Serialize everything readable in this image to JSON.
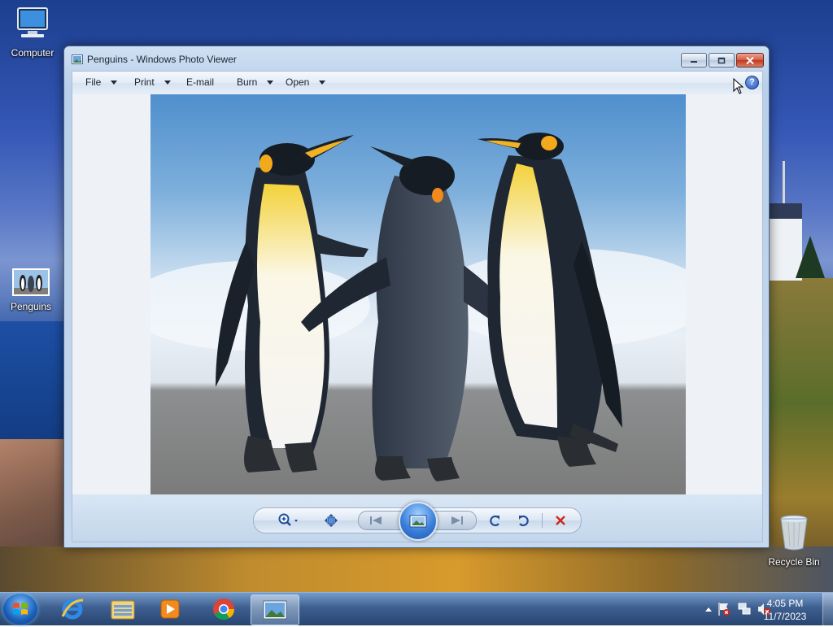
{
  "desktop": {
    "icons": [
      {
        "label": "Computer",
        "icon": "computer-icon"
      },
      {
        "label": "Penguins",
        "icon": "image-thumbnail-icon"
      },
      {
        "label": "Recycle Bin",
        "icon": "recycle-bin-icon"
      }
    ]
  },
  "window": {
    "title": "Penguins - Windows Photo Viewer",
    "app_icon": "photo-viewer-icon",
    "caption_buttons": [
      "minimize",
      "maximize",
      "close"
    ],
    "menu": [
      {
        "label": "File",
        "has_dropdown": true
      },
      {
        "label": "Print",
        "has_dropdown": true
      },
      {
        "label": "E-mail",
        "has_dropdown": false
      },
      {
        "label": "Burn",
        "has_dropdown": true
      },
      {
        "label": "Open",
        "has_dropdown": true
      }
    ],
    "help_icon": "?",
    "image": {
      "subject": "three emperor penguins on a beach"
    },
    "controls": [
      {
        "name": "zoom",
        "icon": "magnifier-zoom-icon",
        "has_dropdown": true
      },
      {
        "name": "actual-size",
        "icon": "fit-to-window-icon"
      },
      {
        "name": "previous",
        "icon": "previous-icon"
      },
      {
        "name": "slideshow",
        "icon": "slideshow-icon"
      },
      {
        "name": "next",
        "icon": "next-icon"
      },
      {
        "name": "rotate-counterclockwise",
        "icon": "rotate-left-icon"
      },
      {
        "name": "rotate-clockwise",
        "icon": "rotate-right-icon"
      },
      {
        "name": "delete",
        "icon": "delete-x-icon"
      }
    ]
  },
  "taskbar": {
    "start": "start-orb-icon",
    "pinned": [
      "internet-explorer-icon",
      "file-explorer-icon",
      "media-player-icon",
      "chrome-icon",
      "photo-viewer-icon"
    ],
    "active": "photo-viewer-icon",
    "tray": [
      "show-hidden-icons-icon",
      "action-center-flag-icon",
      "network-icon",
      "volume-muted-icon"
    ],
    "clock": {
      "time": "4:05 PM",
      "date": "11/7/2023"
    }
  },
  "colors": {
    "accent": "#3b7fd9",
    "close": "#c2361d",
    "delete": "#d0261c"
  }
}
